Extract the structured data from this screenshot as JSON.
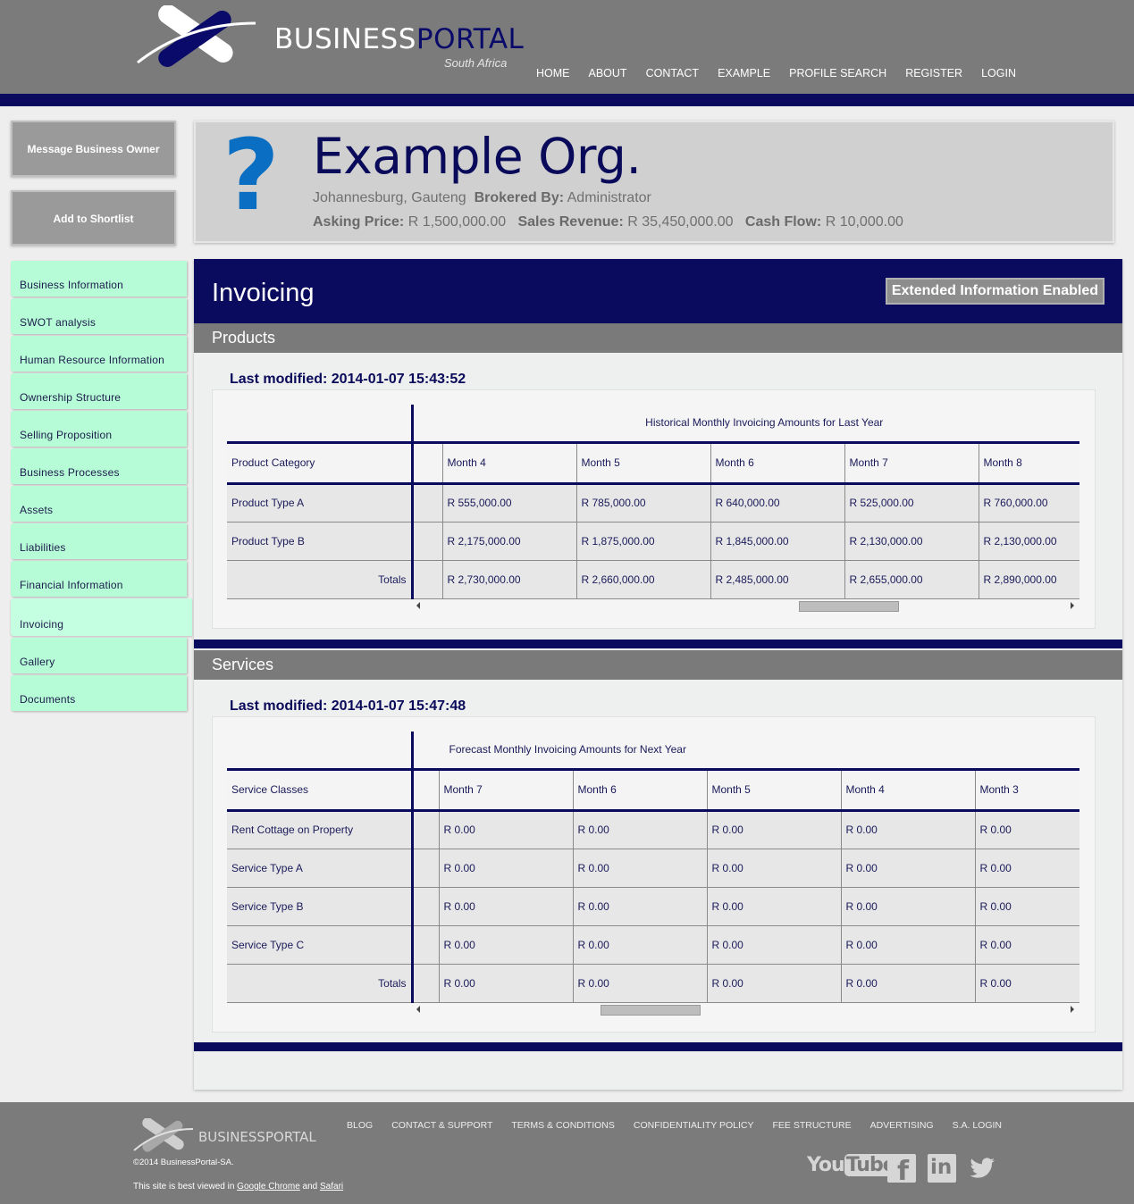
{
  "header": {
    "logo_main": "BUSINESS",
    "logo_accent": "PORTAL",
    "logo_sub": "South Africa",
    "nav": [
      "HOME",
      "ABOUT",
      "CONTACT",
      "EXAMPLE",
      "PROFILE SEARCH",
      "REGISTER",
      "LOGIN"
    ]
  },
  "sidebar": {
    "message_button": "Message Business Owner",
    "shortlist_button": "Add to Shortlist",
    "menu": [
      "Business Information",
      "SWOT analysis",
      "Human Resource Information",
      "Ownership Structure",
      "Selling Proposition",
      "Business Processes",
      "Assets",
      "Liabilities",
      "Financial Information",
      "Invoicing",
      "Gallery",
      "Documents"
    ],
    "active_item": "Invoicing"
  },
  "profile": {
    "placeholder_glyph": "?",
    "name": "Example Org.",
    "location": "Johannesburg, Gauteng",
    "brokered_label": "Brokered By:",
    "brokered_value": "Administrator",
    "asking_label": "Asking Price:",
    "asking_value": "R 1,500,000.00",
    "revenue_label": "Sales Revenue:",
    "revenue_value": "R 35,450,000.00",
    "cashflow_label": "Cash Flow:",
    "cashflow_value": "R 10,000.00"
  },
  "main": {
    "title": "Invoicing",
    "badge": "Extended Information Enabled",
    "products": {
      "section_title": "Products",
      "last_modified": "Last modified: 2014-01-07 15:43:52",
      "caption": "Historical Monthly Invoicing Amounts for Last Year",
      "first_col": "Product Category",
      "months": [
        "Month 4",
        "Month 5",
        "Month 6",
        "Month 7",
        "Month 8"
      ],
      "rows": [
        {
          "label": "Product Type A",
          "values": [
            "R 555,000.00",
            "R 785,000.00",
            "R 640,000.00",
            "R 525,000.00",
            "R 760,000.00"
          ]
        },
        {
          "label": "Product Type B",
          "values": [
            "R 2,175,000.00",
            "R 1,875,000.00",
            "R 1,845,000.00",
            "R 2,130,000.00",
            "R 2,130,000.00"
          ]
        }
      ],
      "totals_label": "Totals",
      "totals": [
        "R 2,730,000.00",
        "R 2,660,000.00",
        "R 2,485,000.00",
        "R 2,655,000.00",
        "R 2,890,000.00"
      ]
    },
    "services": {
      "section_title": "Services",
      "last_modified": "Last modified: 2014-01-07 15:47:48",
      "caption": "Forecast Monthly Invoicing Amounts for Next Year",
      "first_col": "Service Classes",
      "months": [
        "Month 7",
        "Month 6",
        "Month 5",
        "Month 4",
        "Month 3"
      ],
      "rows": [
        {
          "label": "Rent Cottage on Property",
          "values": [
            "R 0.00",
            "R 0.00",
            "R 0.00",
            "R 0.00",
            "R 0.00"
          ]
        },
        {
          "label": "Service Type A",
          "values": [
            "R 0.00",
            "R 0.00",
            "R 0.00",
            "R 0.00",
            "R 0.00"
          ]
        },
        {
          "label": "Service Type B",
          "values": [
            "R 0.00",
            "R 0.00",
            "R 0.00",
            "R 0.00",
            "R 0.00"
          ]
        },
        {
          "label": "Service Type C",
          "values": [
            "R 0.00",
            "R 0.00",
            "R 0.00",
            "R 0.00",
            "R 0.00"
          ]
        }
      ],
      "totals_label": "Totals",
      "totals": [
        "R 0.00",
        "R 0.00",
        "R 0.00",
        "R 0.00",
        "R 0.00"
      ]
    }
  },
  "footer": {
    "logo_main": "BUSINESS",
    "logo_accent": "PORTAL",
    "copyright": "©2014 BusinessPortal-SA.",
    "viewed_prefix": "This site is best viewed in",
    "chrome": "Google Chrome",
    "and": "and",
    "safari": "Safari",
    "nav": [
      "BLOG",
      "CONTACT & SUPPORT",
      "TERMS & CONDITIONS",
      "CONFIDENTIALITY POLICY",
      "FEE STRUCTURE",
      "ADVERTISING",
      "S.A. LOGIN"
    ],
    "youtube_you": "You",
    "youtube_tube": "Tube",
    "facebook_glyph": "f",
    "linkedin_glyph": "in",
    "social_icons": [
      "youtube-icon",
      "facebook-icon",
      "linkedin-icon",
      "twitter-icon"
    ]
  },
  "colors": {
    "navy": "#0a0a5e",
    "gray": "#7b7b7b",
    "mint": "#b5fcd7",
    "link_blue": "#0a6fc2"
  }
}
